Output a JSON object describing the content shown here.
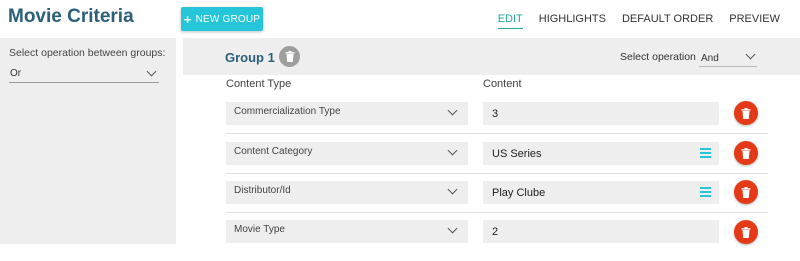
{
  "header": {
    "title": "Movie Criteria",
    "new_group_label": "NEW GROUP",
    "nav": [
      {
        "label": "EDIT",
        "active": true
      },
      {
        "label": "HIGHLIGHTS",
        "active": false
      },
      {
        "label": "DEFAULT ORDER",
        "active": false
      },
      {
        "label": "PREVIEW",
        "active": false
      }
    ]
  },
  "sidebar": {
    "label": "Select operation between groups:",
    "value": "Or"
  },
  "group": {
    "title": "Group 1",
    "select_operation_label": "Select operation",
    "select_operation_value": "And",
    "col_content_type": "Content Type",
    "col_content": "Content",
    "rows": [
      {
        "content_type": "Commercialization Type",
        "content": "3",
        "has_list_icon": false
      },
      {
        "content_type": "Content Category",
        "content": "US Series",
        "has_list_icon": true
      },
      {
        "content_type": "Distributor/Id",
        "content": "Play Clube",
        "has_list_icon": true
      },
      {
        "content_type": "Movie Type",
        "content": "2",
        "has_list_icon": false
      }
    ]
  },
  "colors": {
    "accent_cyan": "#26c6da",
    "title_blue": "#2b5f7a",
    "delete_red": "#e53a17",
    "active_tab": "#26a69a"
  },
  "icons": {
    "add": "plus-icon",
    "delete": "trash-icon",
    "dropdown": "chevron-down-icon",
    "list": "list-icon"
  }
}
